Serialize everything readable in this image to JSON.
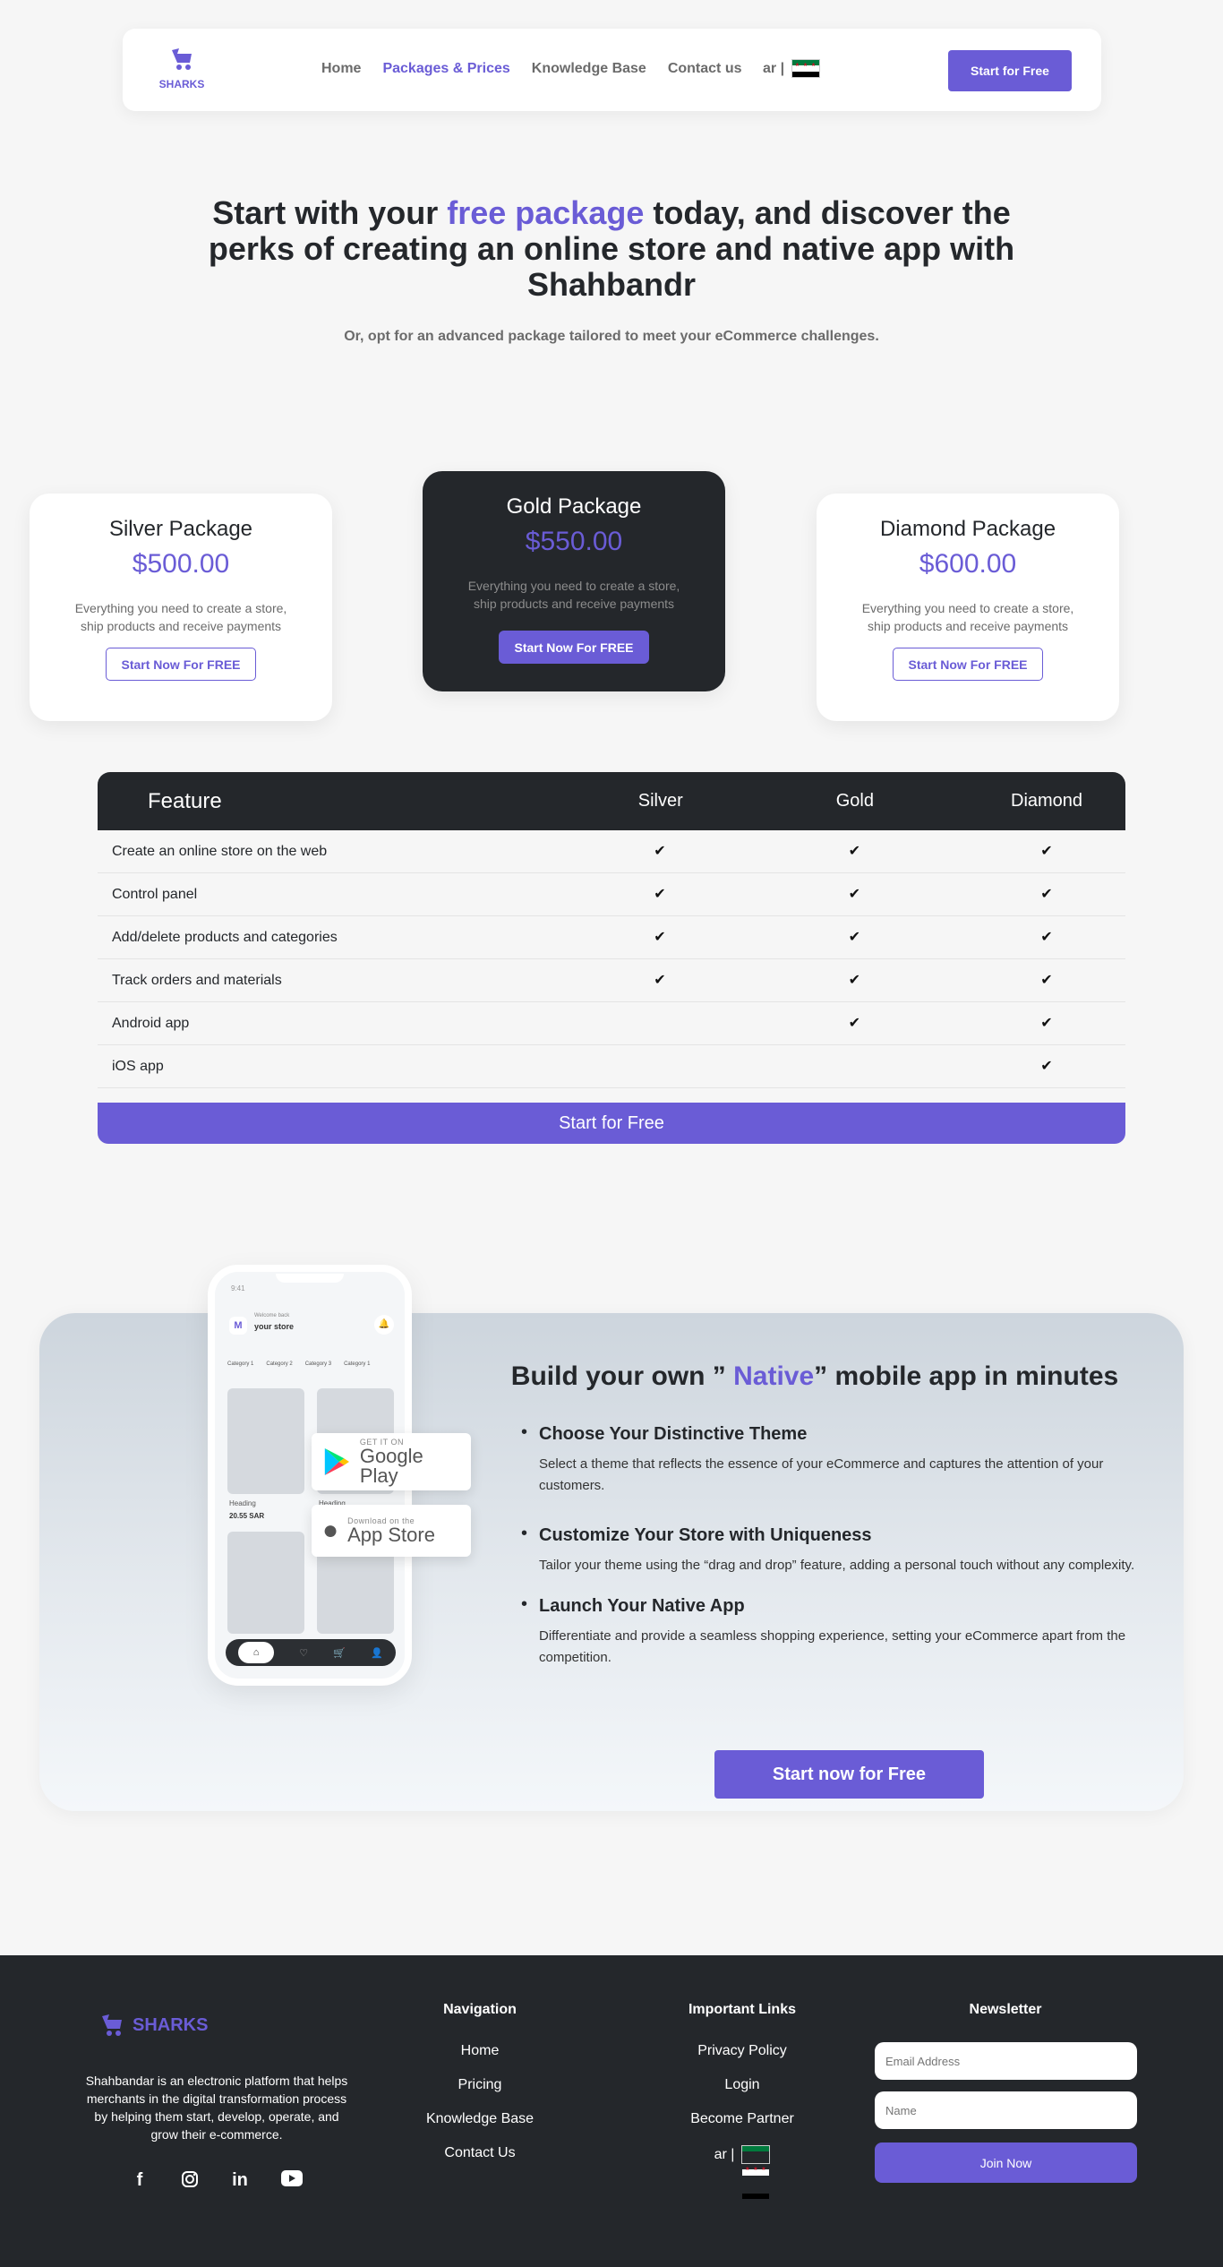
{
  "brand": {
    "name": "SHARKS",
    "accent": "#6a5cd6",
    "dark": "#24272b"
  },
  "nav": {
    "links": [
      "Home",
      "Packages & Prices",
      "Knowledge Base",
      "Contact us"
    ],
    "active": "Packages & Prices",
    "lang": "ar |",
    "cta": "Start for Free"
  },
  "hero": {
    "title_pre": "Start with your ",
    "title_hl": "free package",
    "title_post": " today, and discover the perks of creating an online store and native app with Shahbandr",
    "subtitle": "Or, opt for an advanced package tailored to meet your eCommerce challenges."
  },
  "packages": [
    {
      "name": "Silver Package",
      "price": "$500.00",
      "desc": "Everything you need to create a store, ship products and receive payments",
      "cta": "Start Now For FREE"
    },
    {
      "name": "Gold Package",
      "price": "$550.00",
      "desc": "Everything you need to create a store, ship products and receive payments",
      "cta": "Start Now For FREE"
    },
    {
      "name": "Diamond Package",
      "price": "$600.00",
      "desc": "Everything you need to create a store, ship products and receive payments",
      "cta": "Start Now For FREE"
    }
  ],
  "table": {
    "headers": [
      "Feature",
      "Silver",
      "Gold",
      "Diamond"
    ],
    "rows": [
      {
        "feature": "Create an online store on the web",
        "silver": true,
        "gold": true,
        "diamond": true
      },
      {
        "feature": "Control panel",
        "silver": true,
        "gold": true,
        "diamond": true
      },
      {
        "feature": "Add/delete products and categories",
        "silver": true,
        "gold": true,
        "diamond": true
      },
      {
        "feature": "Track orders and materials",
        "silver": true,
        "gold": true,
        "diamond": true
      },
      {
        "feature": "Android app",
        "silver": false,
        "gold": true,
        "diamond": true
      },
      {
        "feature": "iOS app",
        "silver": false,
        "gold": false,
        "diamond": true
      }
    ],
    "cta": "Start for Free"
  },
  "app": {
    "title_pre": "Build your own ” ",
    "title_hl": "Native",
    "title_post": "” mobile app in minutes",
    "features": [
      {
        "title": "Choose Your Distinctive Theme",
        "text": "Select a theme that reflects the essence of your eCommerce and captures the attention of your customers."
      },
      {
        "title": "Customize Your Store with Uniqueness",
        "text": "Tailor your theme using the “drag and drop” feature, adding a personal touch without any complexity."
      },
      {
        "title": "Launch Your Native App",
        "text": "Differentiate and provide a seamless shopping experience, setting your eCommerce apart from the competition."
      }
    ],
    "cta": "Start now for Free",
    "phone": {
      "time": "9:41",
      "welcome": "Welcome back",
      "store": "your store",
      "categories": [
        "Category 1",
        "Category 2",
        "Category 3",
        "Category 1"
      ],
      "heading": "Heading",
      "amount": "20.55 SAR"
    },
    "google_play": {
      "small": "GET IT ON",
      "big": "Google Play"
    },
    "app_store": {
      "small": "Download on the",
      "big": "App Store"
    }
  },
  "footer": {
    "about": "Shahbandar is an electronic platform that helps merchants in the digital transformation process by helping them start, develop, operate, and grow their e-commerce.",
    "social": [
      "facebook-icon",
      "instagram-icon",
      "linkedin-icon",
      "youtube-icon"
    ],
    "navigation": {
      "title": "Navigation",
      "items": [
        "Home",
        "Pricing",
        "Knowledge Base",
        "Contact Us"
      ]
    },
    "links": {
      "title": "Important Links",
      "items": [
        "Privacy Policy",
        "Login",
        "Become Partner"
      ],
      "lang": "ar |"
    },
    "newsletter": {
      "title": "Newsletter",
      "email_placeholder": "Email Address",
      "name_placeholder": "Name",
      "cta": "Join Now"
    }
  }
}
